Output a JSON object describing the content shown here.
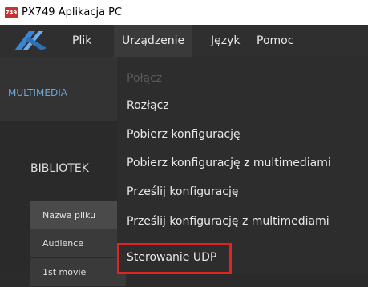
{
  "window": {
    "title": "PX749 Aplikacja PC",
    "icon_text": "749"
  },
  "menubar": {
    "items": [
      "Plik",
      "Urządzenie",
      "Język",
      "Pomoc"
    ],
    "active": "Urządzenie"
  },
  "main": {
    "tab": "MULTIMEDIA",
    "library_label": "BIBLIOTEK",
    "table": {
      "header": "Nazwa pliku",
      "rows": [
        "Audience",
        "1st movie"
      ]
    }
  },
  "dropdown": {
    "items": [
      {
        "label": "Połącz",
        "enabled": false
      },
      {
        "label": "Rozłącz",
        "enabled": true
      },
      {
        "label": "Pobierz konfigurację",
        "enabled": true
      },
      {
        "label": "Pobierz konfigurację z multimediami",
        "enabled": true
      },
      {
        "label": "Prześlij konfigurację",
        "enabled": true
      },
      {
        "label": "Prześlij konfigurację z multimediami",
        "enabled": true
      },
      {
        "label": "Sterowanie UDP",
        "enabled": true,
        "highlighted": true
      }
    ]
  },
  "colors": {
    "accent": "#6aa6d8",
    "highlight": "#e32222",
    "menubar": "#2f2f2f"
  }
}
